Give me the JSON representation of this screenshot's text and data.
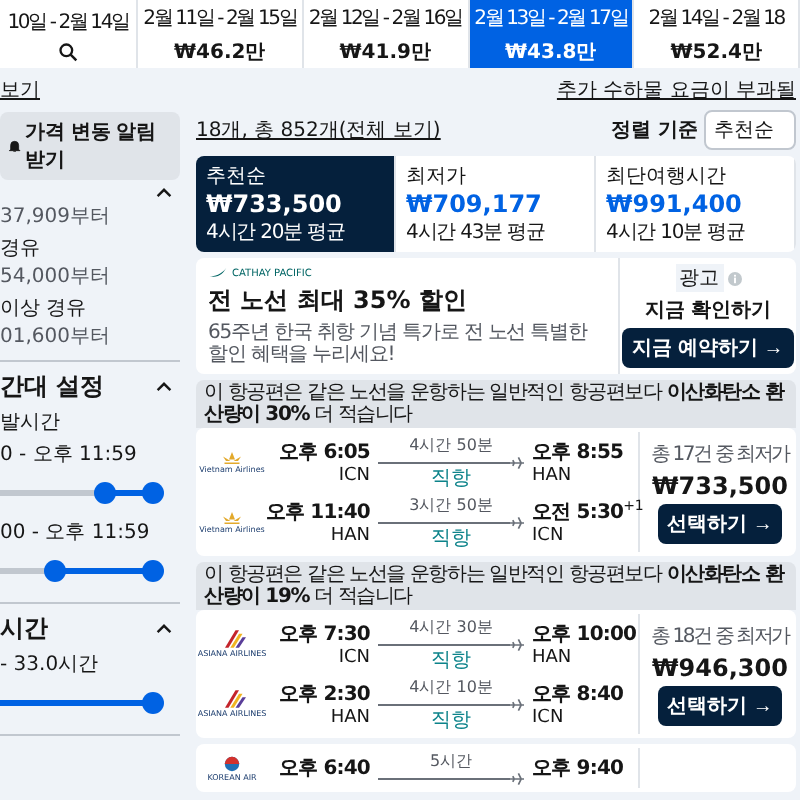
{
  "date_strip": [
    {
      "kind": "search",
      "dates": "10일 - 2월 14일",
      "selected": false
    },
    {
      "kind": "price",
      "dates": "2월 11일 - 2월 15일",
      "price": "₩46.2만",
      "selected": false
    },
    {
      "kind": "price",
      "dates": "2월 12일 - 2월 16일",
      "price": "₩41.9만",
      "selected": false
    },
    {
      "kind": "price",
      "dates": "2월 13일 - 2월 17일",
      "price": "₩43.8만",
      "selected": true
    },
    {
      "kind": "price",
      "dates": "2월 14일 - 2월 18",
      "price": "₩52.4만",
      "selected": false
    }
  ],
  "sidebar": {
    "link": "보기",
    "alert_button": "가격 변동 알림 받기",
    "sections": [
      {
        "kind": "options",
        "expanded": true,
        "options": [
          {
            "price": "37,909부터"
          },
          {
            "label": "경유",
            "price": "54,000부터"
          },
          {
            "label": "이상 경유",
            "price": "01,600부터"
          }
        ]
      },
      {
        "kind": "sliders",
        "title": "간대 설정",
        "expanded": true,
        "sliders": [
          {
            "label": "발시간",
            "range": "0 - 오후 11:59",
            "thumbs": [
              {
                "level": 0.68
              },
              {
                "level": 1
              }
            ]
          },
          {
            "range": "00 - 오후 11:59",
            "thumbs": [
              {
                "level": 0.36
              },
              {
                "level": 1
              }
            ]
          }
        ]
      },
      {
        "kind": "sliders",
        "title": "시간",
        "expanded": true,
        "sliders": [
          {
            "range": "- 33.0시간",
            "thumbs": [
              {
                "level": 1
              }
            ]
          }
        ]
      }
    ]
  },
  "main": {
    "baggage_note": "추가 수하물 요금이 부과될",
    "results_count": "18개, 총 852개(전체 보기)",
    "sort_label": "정렬 기준",
    "sort_value": "추천순",
    "sort_tabs": [
      {
        "label": "추천순",
        "price": "₩733,500",
        "duration": "4시간 20분 평균",
        "selected": true
      },
      {
        "label": "최저가",
        "price": "₩709,177",
        "duration": "4시간 43분 평균",
        "selected": false
      },
      {
        "label": "최단여행시간",
        "price": "₩991,400",
        "duration": "4시간 10분 평균",
        "selected": false
      }
    ],
    "ad": {
      "logo": "CATHAY PACIFIC",
      "headline": "전 노선 최대 35% 할인",
      "body": "65주년 한국 취항 기념 특가로 전 노선 특별한 할인 혜택을 누리세요!",
      "badge": "광고",
      "cta_text": "지금 확인하기",
      "button": "지금 예약하기 →"
    },
    "flights": [
      {
        "emission_note": "이 항공편은 같은 노선을 운항하는 일반적인 항공편보다 **이산화탄소 환산량이 30%** 더 적습니다",
        "kind": "lotus",
        "legs": [
          {
            "airline": "Vietnam Airlines",
            "dep_time": "오후 6:05",
            "dep_airport": "ICN",
            "duration": "4시간 50분",
            "stops": "직항",
            "arr_time": "오후 8:55",
            "arr_airport": "HAN"
          },
          {
            "airline": "Vietnam Airlines",
            "dep_time": "오후 11:40",
            "dep_airport": "HAN",
            "duration": "3시간 50분",
            "stops": "직항",
            "arr_time": "오전 5:30",
            "day_offset": "+1",
            "arr_airport": "ICN"
          }
        ],
        "deal_note": "총 17건 중 최저가",
        "price": "₩733,500",
        "button": "선택하기 →"
      },
      {
        "emission_note": "이 항공편은 같은 노선을 운항하는 일반적인 항공편보다 **이산화탄소 환산량이 19%** 더 적습니다",
        "kind": "stripes",
        "legs": [
          {
            "airline": "ASIANA AIRLINES",
            "dep_time": "오후 7:30",
            "dep_airport": "ICN",
            "duration": "4시간 30분",
            "stops": "직항",
            "arr_time": "오후 10:00",
            "arr_airport": "HAN"
          },
          {
            "airline": "ASIANA AIRLINES",
            "dep_time": "오후 2:30",
            "dep_airport": "HAN",
            "duration": "4시간 10분",
            "stops": "직항",
            "arr_time": "오후 8:40",
            "arr_airport": "ICN"
          }
        ],
        "deal_note": "총 18건 중 최저가",
        "price": "₩946,300",
        "button": "선택하기 →"
      },
      {
        "kind": "taeguk",
        "legs": [
          {
            "airline": "KOREAN AIR",
            "dep_time": "오후 6:40",
            "duration": "5시간",
            "arr_time": "오후 9:40"
          }
        ]
      }
    ]
  }
}
